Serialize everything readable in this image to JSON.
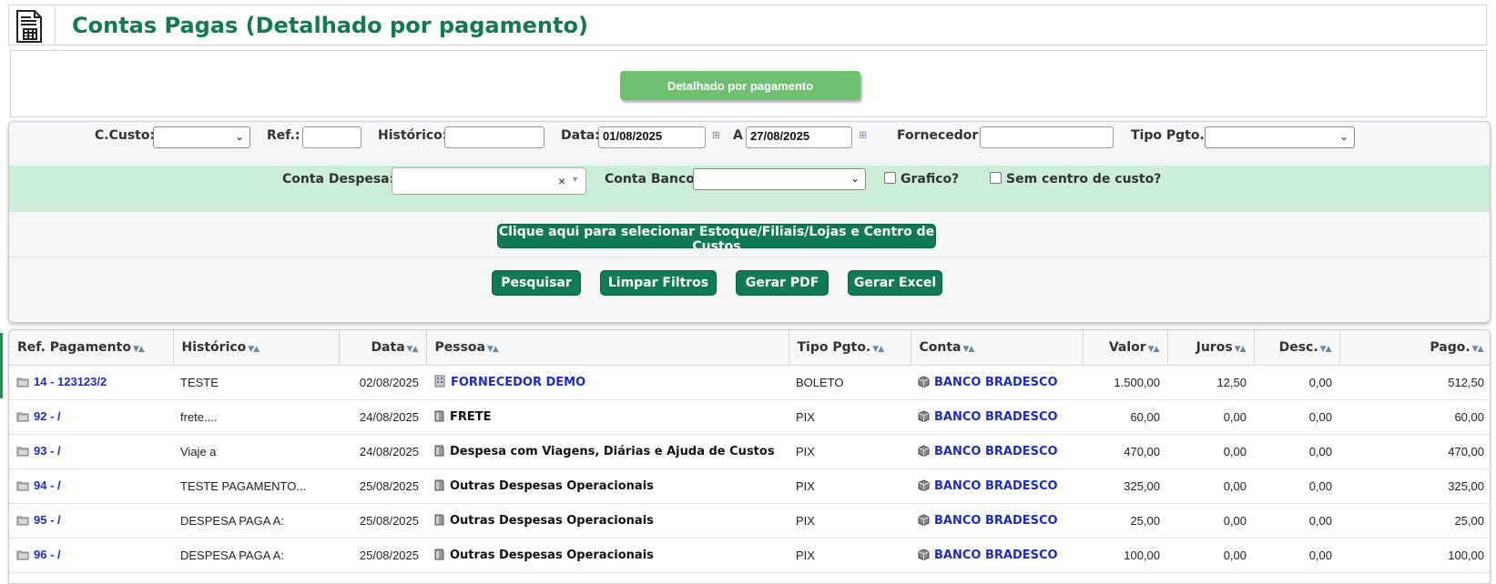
{
  "header": {
    "title": "Contas Pagas (Detalhado por pagamento)",
    "icon": "calculator-document-icon"
  },
  "mode": {
    "label": "Detalhado por pagamento"
  },
  "filters": {
    "ccusto_label": "C.Custo:",
    "ref_label": "Ref.:",
    "historico_label": "Histórico:",
    "data_label": "Data:",
    "data_de": "01/08/2025",
    "a_label": "A",
    "data_ate": "27/08/2025",
    "fornecedor_label": "Fornecedor:",
    "tipo_pgto_label": "Tipo Pgto.:",
    "conta_despesa_label": "Conta Despesa:",
    "conta_despesa_clear": "×",
    "conta_banco_label": "Conta Banco:",
    "grafico_label": "Grafico?",
    "sem_centro_label": "Sem centro de custo?",
    "estoque_button": "Clique aqui para selecionar Estoque/Filiais/Lojas e Centro de Custos",
    "pesquisar": "Pesquisar",
    "limpar": "Limpar Filtros",
    "gerar_pdf": "Gerar PDF",
    "gerar_excel": "Gerar Excel"
  },
  "table": {
    "columns": [
      "Ref. Pagamento",
      "Histórico",
      "Data",
      "Pessoa",
      "Tipo Pgto.",
      "Conta",
      "Valor",
      "Juros",
      "Desc.",
      "Pago."
    ],
    "sort_glyph": "▼▲",
    "rows": [
      {
        "ref": "14 - 123123/2",
        "historico": "TESTE",
        "data": "02/08/2025",
        "pessoa": "FORNECEDOR DEMO",
        "pessoa_link": true,
        "tipo": "BOLETO",
        "conta": "BANCO BRADESCO",
        "valor": "1.500,00",
        "juros": "12,50",
        "desc": "0,00",
        "pago": "512,50"
      },
      {
        "ref": "92 - /",
        "historico": "frete....",
        "data": "24/08/2025",
        "pessoa": "FRETE",
        "pessoa_link": false,
        "tipo": "PIX",
        "conta": "BANCO BRADESCO",
        "valor": "60,00",
        "juros": "0,00",
        "desc": "0,00",
        "pago": "60,00"
      },
      {
        "ref": "93 - /",
        "historico": "Viaje a",
        "data": "24/08/2025",
        "pessoa": "Despesa com Viagens, Diárias e Ajuda de Custos",
        "pessoa_link": false,
        "tipo": "PIX",
        "conta": "BANCO BRADESCO",
        "valor": "470,00",
        "juros": "0,00",
        "desc": "0,00",
        "pago": "470,00"
      },
      {
        "ref": "94 - /",
        "historico": "TESTE PAGAMENTO...",
        "data": "25/08/2025",
        "pessoa": "Outras Despesas Operacionais",
        "pessoa_link": false,
        "tipo": "PIX",
        "conta": "BANCO BRADESCO",
        "valor": "325,00",
        "juros": "0,00",
        "desc": "0,00",
        "pago": "325,00"
      },
      {
        "ref": "95 - /",
        "historico": "DESPESA PAGA A:",
        "data": "25/08/2025",
        "pessoa": "Outras Despesas Operacionais",
        "pessoa_link": false,
        "tipo": "PIX",
        "conta": "BANCO BRADESCO",
        "valor": "25,00",
        "juros": "0,00",
        "desc": "0,00",
        "pago": "25,00"
      },
      {
        "ref": "96 - /",
        "historico": "DESPESA PAGA A:",
        "data": "25/08/2025",
        "pessoa": "Outras Despesas Operacionais",
        "pessoa_link": false,
        "tipo": "PIX",
        "conta": "BANCO BRADESCO",
        "valor": "100,00",
        "juros": "0,00",
        "desc": "0,00",
        "pago": "100,00"
      }
    ]
  },
  "colors": {
    "brand": "#107a55",
    "mode_button": "#6cc070",
    "filter_highlight": "#cdeed6",
    "link": "#1a2cc9"
  }
}
